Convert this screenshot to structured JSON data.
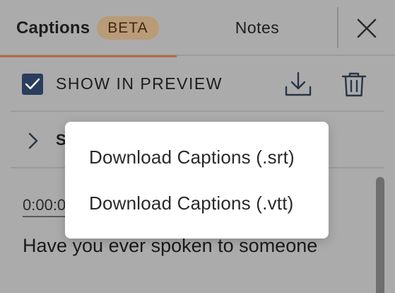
{
  "tabs": {
    "captions_label": "Captions",
    "beta_badge": "BETA",
    "notes_label": "Notes"
  },
  "toolbar": {
    "show_in_preview_label": "SHOW IN PREVIEW",
    "show_in_preview_checked": true
  },
  "style_section": {
    "label_partial": "S"
  },
  "captions": [
    {
      "timestamp": "0:00:0",
      "text": "Have you ever spoken to someone"
    }
  ],
  "download_menu": {
    "items": [
      {
        "label": "Download Captions (.srt)"
      },
      {
        "label": "Download Captions (.vtt)"
      }
    ]
  },
  "colors": {
    "accent_underline": "#b86b3f",
    "beta_badge_bg": "#b99b78",
    "checkbox_bg": "#2a3d5e",
    "overlay_bg": "#ababab"
  },
  "icons": [
    "close-icon",
    "checkmark-icon",
    "download-icon",
    "trash-icon",
    "chevron-right-icon"
  ]
}
